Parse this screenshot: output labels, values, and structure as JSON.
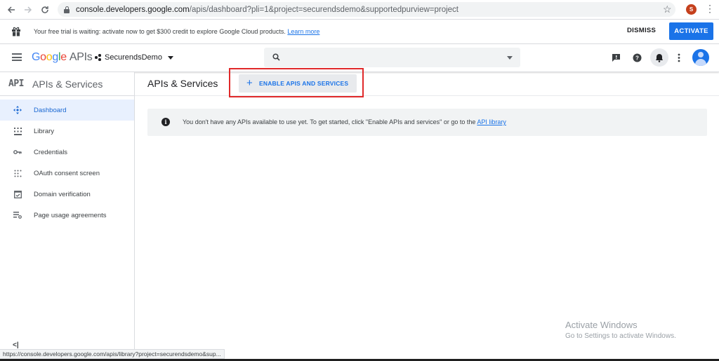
{
  "browser": {
    "url_host": "console.developers.google.com",
    "url_path": "/apis/dashboard?pli=1&project=securendsdemo&supportedpurview=project",
    "profile_initial": "S"
  },
  "banner": {
    "text": "Your free trial is waiting: activate now to get $300 credit to explore Google Cloud products.",
    "link_label": "Learn more",
    "dismiss_label": "DISMISS",
    "activate_label": "ACTIVATE"
  },
  "header": {
    "logo_letters": [
      "G",
      "o",
      "o",
      "g",
      "l",
      "e"
    ],
    "logo_suffix": "APIs",
    "project_name": "SecurendsDemo",
    "search_placeholder": ""
  },
  "sidebar": {
    "badge": "API",
    "title": "APIs & Services",
    "items": [
      {
        "label": "Dashboard",
        "icon": "dashboard-icon",
        "active": true
      },
      {
        "label": "Library",
        "icon": "library-icon",
        "active": false
      },
      {
        "label": "Credentials",
        "icon": "key-icon",
        "active": false
      },
      {
        "label": "OAuth consent screen",
        "icon": "oauth-icon",
        "active": false
      },
      {
        "label": "Domain verification",
        "icon": "domain-verification-icon",
        "active": false
      },
      {
        "label": "Page usage agreements",
        "icon": "agreements-icon",
        "active": false
      }
    ],
    "collapse_label": "<|"
  },
  "main": {
    "title": "APIs & Services",
    "enable_button_label": "ENABLE APIS AND SERVICES",
    "info_text": "You don't have any APIs available to use yet. To get started, click \"Enable APIs and services\" or go to the",
    "info_link": "API library"
  },
  "watermark": {
    "title": "Activate Windows",
    "subtitle": "Go to Settings to activate Windows."
  },
  "status_bar": {
    "url": "https://console.developers.google.com/apis/library?project=securendsdemo&sup..."
  },
  "colors": {
    "accent": "#1a73e8",
    "highlight": "#e0292a",
    "active_bg": "#e8f0fe"
  }
}
